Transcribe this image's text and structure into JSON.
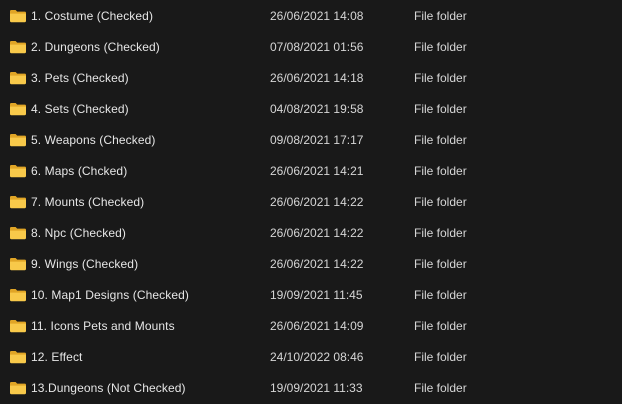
{
  "colors": {
    "background": "#191919",
    "text": "#e6e6e6",
    "folder_back": "#e0a526",
    "folder_front": "#f8c94a"
  },
  "icon": "folder-icon",
  "files": [
    {
      "name": "1. Costume (Checked)",
      "date": "26/06/2021 14:08",
      "type": "File folder"
    },
    {
      "name": "2. Dungeons (Checked)",
      "date": "07/08/2021 01:56",
      "type": "File folder"
    },
    {
      "name": "3. Pets (Checked)",
      "date": "26/06/2021 14:18",
      "type": "File folder"
    },
    {
      "name": "4. Sets (Checked)",
      "date": "04/08/2021 19:58",
      "type": "File folder"
    },
    {
      "name": "5. Weapons (Checked)",
      "date": "09/08/2021 17:17",
      "type": "File folder"
    },
    {
      "name": "6. Maps (Chcked)",
      "date": "26/06/2021 14:21",
      "type": "File folder"
    },
    {
      "name": "7. Mounts (Checked)",
      "date": "26/06/2021 14:22",
      "type": "File folder"
    },
    {
      "name": "8. Npc (Checked)",
      "date": "26/06/2021 14:22",
      "type": "File folder"
    },
    {
      "name": "9. Wings (Checked)",
      "date": "26/06/2021 14:22",
      "type": "File folder"
    },
    {
      "name": "10. Map1 Designs (Checked)",
      "date": "19/09/2021 11:45",
      "type": "File folder"
    },
    {
      "name": "11. Icons Pets and Mounts",
      "date": "26/06/2021 14:09",
      "type": "File folder"
    },
    {
      "name": "12. Effect",
      "date": "24/10/2022 08:46",
      "type": "File folder"
    },
    {
      "name": "13.Dungeons (Not Checked)",
      "date": "19/09/2021 11:33",
      "type": "File folder"
    }
  ]
}
